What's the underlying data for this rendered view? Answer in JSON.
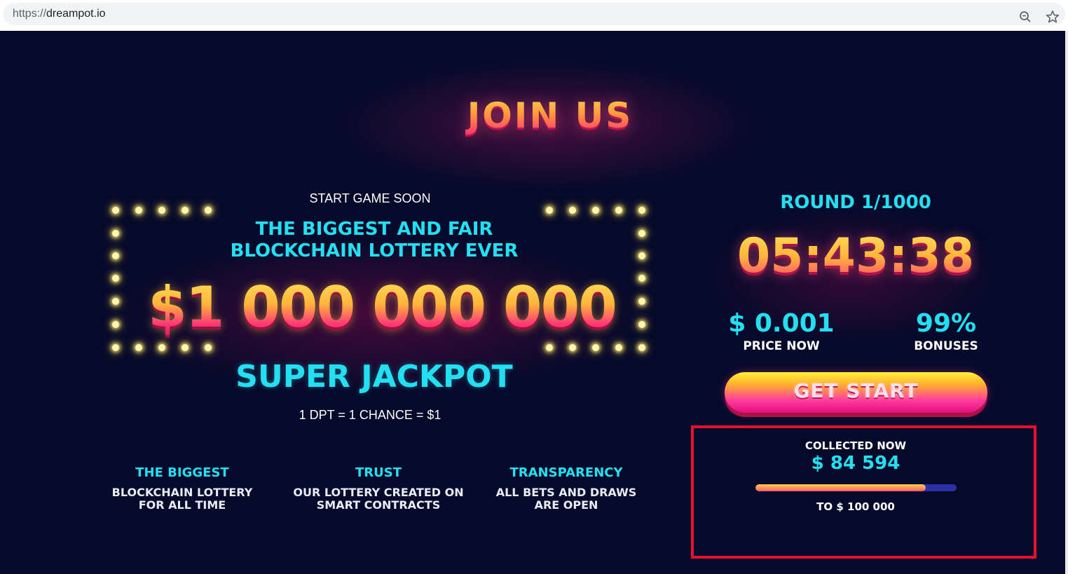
{
  "browser": {
    "url_scheme": "https://",
    "url_host": "dreampot.io",
    "icons": [
      "zoom-icon",
      "star-icon"
    ]
  },
  "hero": {
    "title": "JOIN US",
    "start_soon": "START GAME SOON",
    "headline_line1": "THE BIGGEST AND FAIR",
    "headline_line2": "BLOCKCHAIN LOTTERY EVER",
    "jackpot_amount": "$1 000 000 000",
    "jackpot_label": "SUPER JACKPOT",
    "exchange_note": "1 DPT = 1 CHANCE = $1"
  },
  "features": [
    {
      "title": "THE BIGGEST",
      "line1": "BLOCKCHAIN LOTTERY",
      "line2": "FOR ALL TIME"
    },
    {
      "title": "TRUST",
      "line1": "OUR LOTTERY CREATED ON",
      "line2": "SMART CONTRACTS"
    },
    {
      "title": "TRANSPARENCY",
      "line1": "ALL BETS AND DRAWS",
      "line2": "ARE OPEN"
    }
  ],
  "round_panel": {
    "round": "ROUND 1/1000",
    "timer": "05:43:38",
    "price_value": "$ 0.001",
    "price_label": "PRICE NOW",
    "bonus_value": "99%",
    "bonus_label": "BONUSES",
    "button_label": "GET START"
  },
  "collected": {
    "label": "COLLECTED NOW",
    "value": "$ 84 594",
    "target": "TO $ 100 000",
    "progress_fraction": 0.846
  },
  "colors": {
    "background": "#050a2a",
    "accent_cyan": "#22e0f2",
    "highlight_border": "#e8102e",
    "progress_track": "#2b2fa8"
  }
}
